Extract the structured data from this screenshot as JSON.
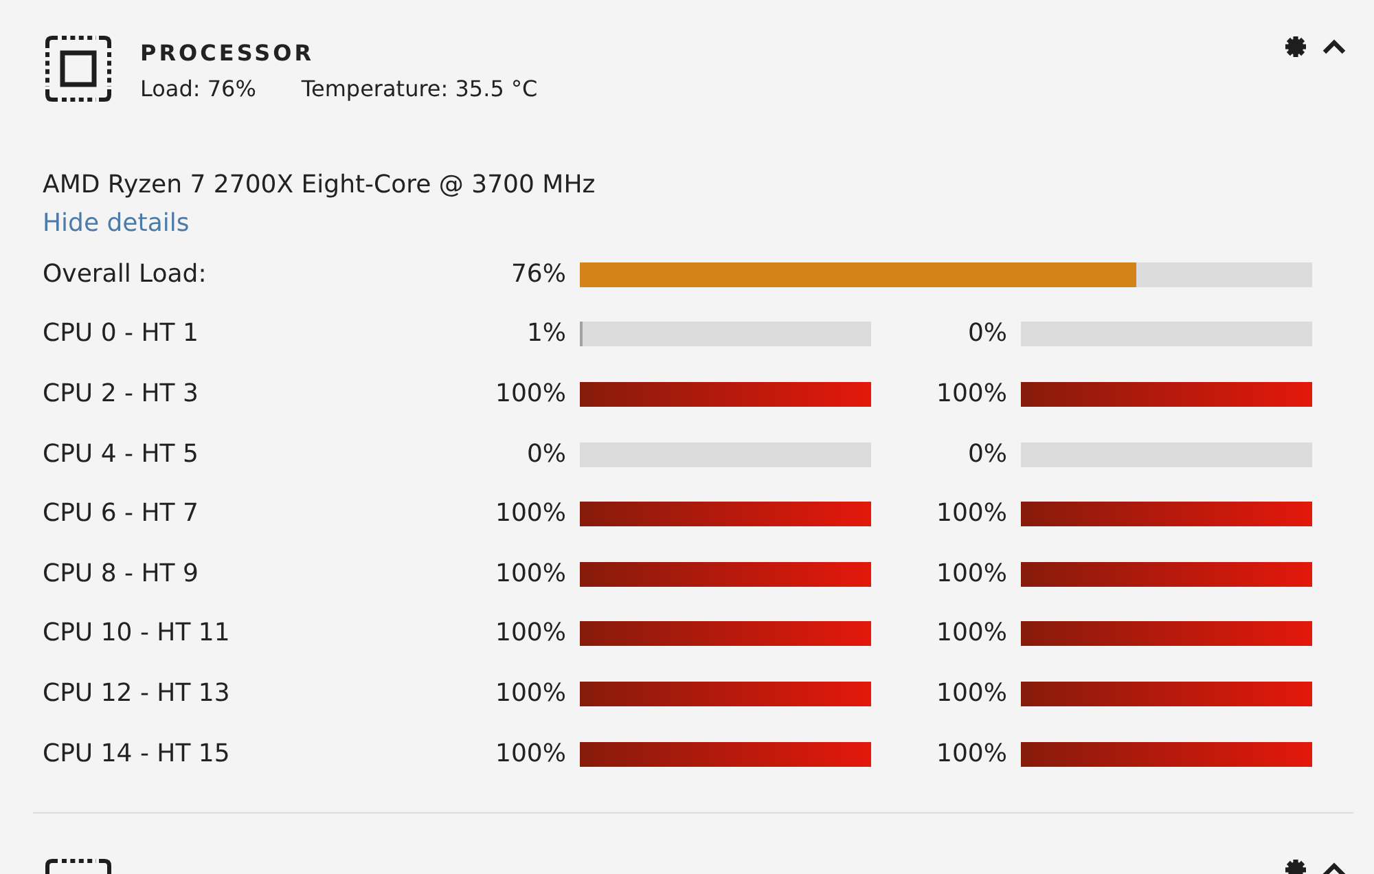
{
  "panel": {
    "title": "PROCESSOR",
    "load": "Load: 76%",
    "temperature": "Temperature: 35.5 °C"
  },
  "model": "AMD Ryzen 7 2700X Eight-Core @ 3700 MHz",
  "details_link": "Hide details",
  "overall": {
    "label": "Overall Load:",
    "reading": "76%",
    "level": 0.76
  },
  "cores": [
    {
      "label": "CPU 0 - HT 1",
      "threads": [
        {
          "reading": "1%",
          "level": 0.01
        },
        {
          "reading": "0%",
          "level": 0
        }
      ]
    },
    {
      "label": "CPU 2 - HT 3",
      "threads": [
        {
          "reading": "100%",
          "level": 1
        },
        {
          "reading": "100%",
          "level": 1
        }
      ]
    },
    {
      "label": "CPU 4 - HT 5",
      "threads": [
        {
          "reading": "0%",
          "level": 0
        },
        {
          "reading": "0%",
          "level": 0
        }
      ]
    },
    {
      "label": "CPU 6 - HT 7",
      "threads": [
        {
          "reading": "100%",
          "level": 1
        },
        {
          "reading": "100%",
          "level": 1
        }
      ]
    },
    {
      "label": "CPU 8 - HT 9",
      "threads": [
        {
          "reading": "100%",
          "level": 1
        },
        {
          "reading": "100%",
          "level": 1
        }
      ]
    },
    {
      "label": "CPU 10 - HT 11",
      "threads": [
        {
          "reading": "100%",
          "level": 1
        },
        {
          "reading": "100%",
          "level": 1
        }
      ]
    },
    {
      "label": "CPU 12 - HT 13",
      "threads": [
        {
          "reading": "100%",
          "level": 1
        },
        {
          "reading": "100%",
          "level": 1
        }
      ]
    },
    {
      "label": "CPU 14 - HT 15",
      "threads": [
        {
          "reading": "100%",
          "level": 1
        },
        {
          "reading": "100%",
          "level": 1
        }
      ]
    }
  ]
}
